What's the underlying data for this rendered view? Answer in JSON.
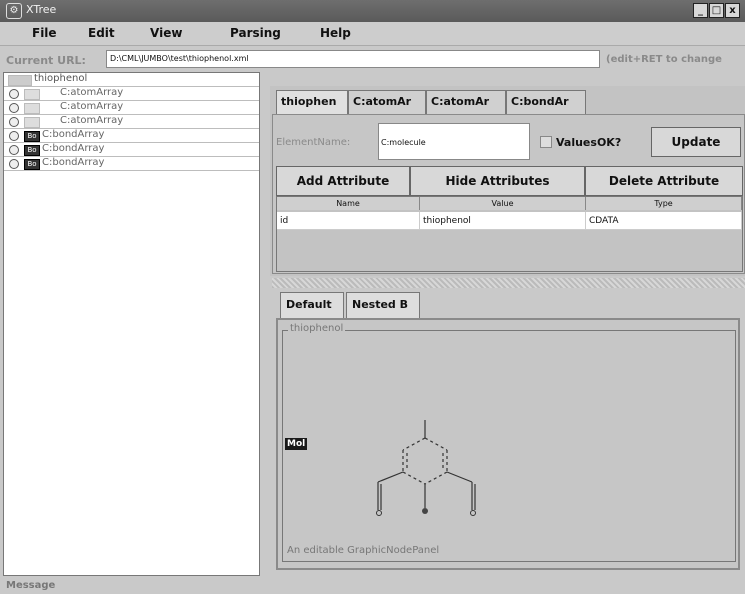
{
  "window": {
    "title": "XTree",
    "controls": [
      "_",
      "□",
      "x"
    ]
  },
  "menu": [
    "File",
    "Edit",
    "View",
    "Parsing",
    "Help"
  ],
  "url_bar": {
    "label": "Current URL:",
    "value": "D:\\CML\\JUMBO\\test\\thiophenol.xml",
    "hint": "(edit+RET to change"
  },
  "tree": {
    "root": "thiophenol",
    "items": [
      {
        "label": "C:atomArray",
        "chip": ""
      },
      {
        "label": "C:atomArray",
        "chip": ""
      },
      {
        "label": "C:atomArray",
        "chip": ""
      },
      {
        "label": "C:bondArray",
        "chip": "Bo"
      },
      {
        "label": "C:bondArray",
        "chip": "Bo"
      },
      {
        "label": "C:bondArray",
        "chip": "Bo"
      }
    ]
  },
  "tabs": [
    "thiophen",
    "C:atomAr",
    "C:atomAr",
    "C:bondAr"
  ],
  "editor": {
    "element_name_label": "ElementName:",
    "element_name_value": "C:molecule",
    "values_ok_label": "ValuesOK?",
    "update_button": "Update",
    "add_button": "Add Attribute",
    "hide_button": "Hide Attributes",
    "delete_button": "Delete Attribute"
  },
  "attributes": {
    "headers": [
      "Name",
      "Value",
      "Type"
    ],
    "rows": [
      [
        "id",
        "thiophenol",
        "CDATA"
      ]
    ]
  },
  "lower_tabs": [
    "Default",
    "Nested B"
  ],
  "graphic": {
    "group_title": "thiophenol",
    "mol_tag": "Mol",
    "status": "An editable GraphicNodePanel"
  },
  "status_bar": "Message"
}
